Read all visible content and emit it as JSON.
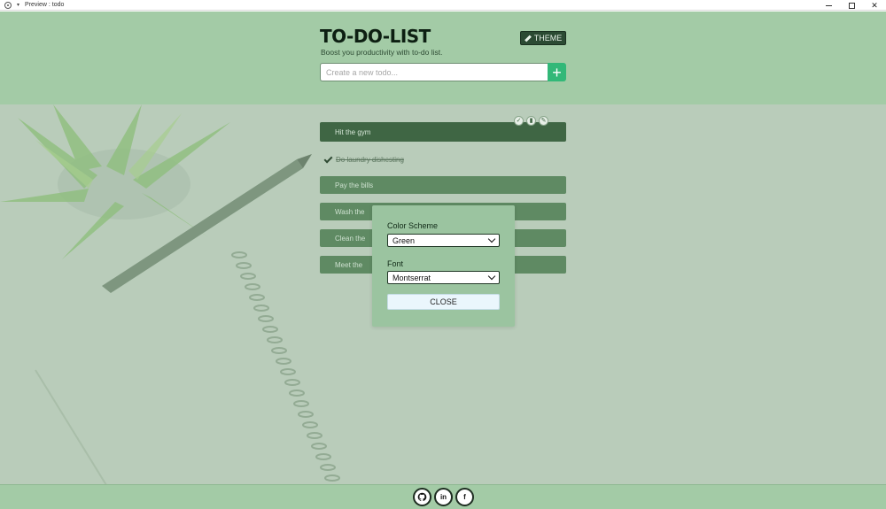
{
  "window": {
    "title": "Preview : todo"
  },
  "header": {
    "title": "TO-DO-LIST",
    "subtitle": "Boost you productivity with to-do list.",
    "theme_button": "THEME",
    "input_placeholder": "Create a new todo...",
    "add_button": "+"
  },
  "todos": [
    {
      "text": "Hit the gym",
      "done": false
    },
    {
      "text": "Do laundry dishesting",
      "done": true
    },
    {
      "text": "Pay the bills",
      "done": false
    },
    {
      "text": "Wash the",
      "done": false
    },
    {
      "text": "Clean the",
      "done": false
    },
    {
      "text": "Meet the",
      "done": false
    }
  ],
  "modal": {
    "color_scheme_label": "Color Scheme",
    "color_scheme_value": "Green",
    "font_label": "Font",
    "font_value": "Montserrat",
    "close_label": "CLOSE"
  },
  "footer": {
    "icons": [
      "github-icon",
      "linkedin-icon",
      "facebook-icon"
    ],
    "linkedin_text": "in",
    "facebook_text": "f"
  },
  "colors": {
    "header_bg": "#a3cba6",
    "todo_bg": "#5f8a63",
    "add_button": "#32b878",
    "modal_bg": "#9bc4a0"
  }
}
